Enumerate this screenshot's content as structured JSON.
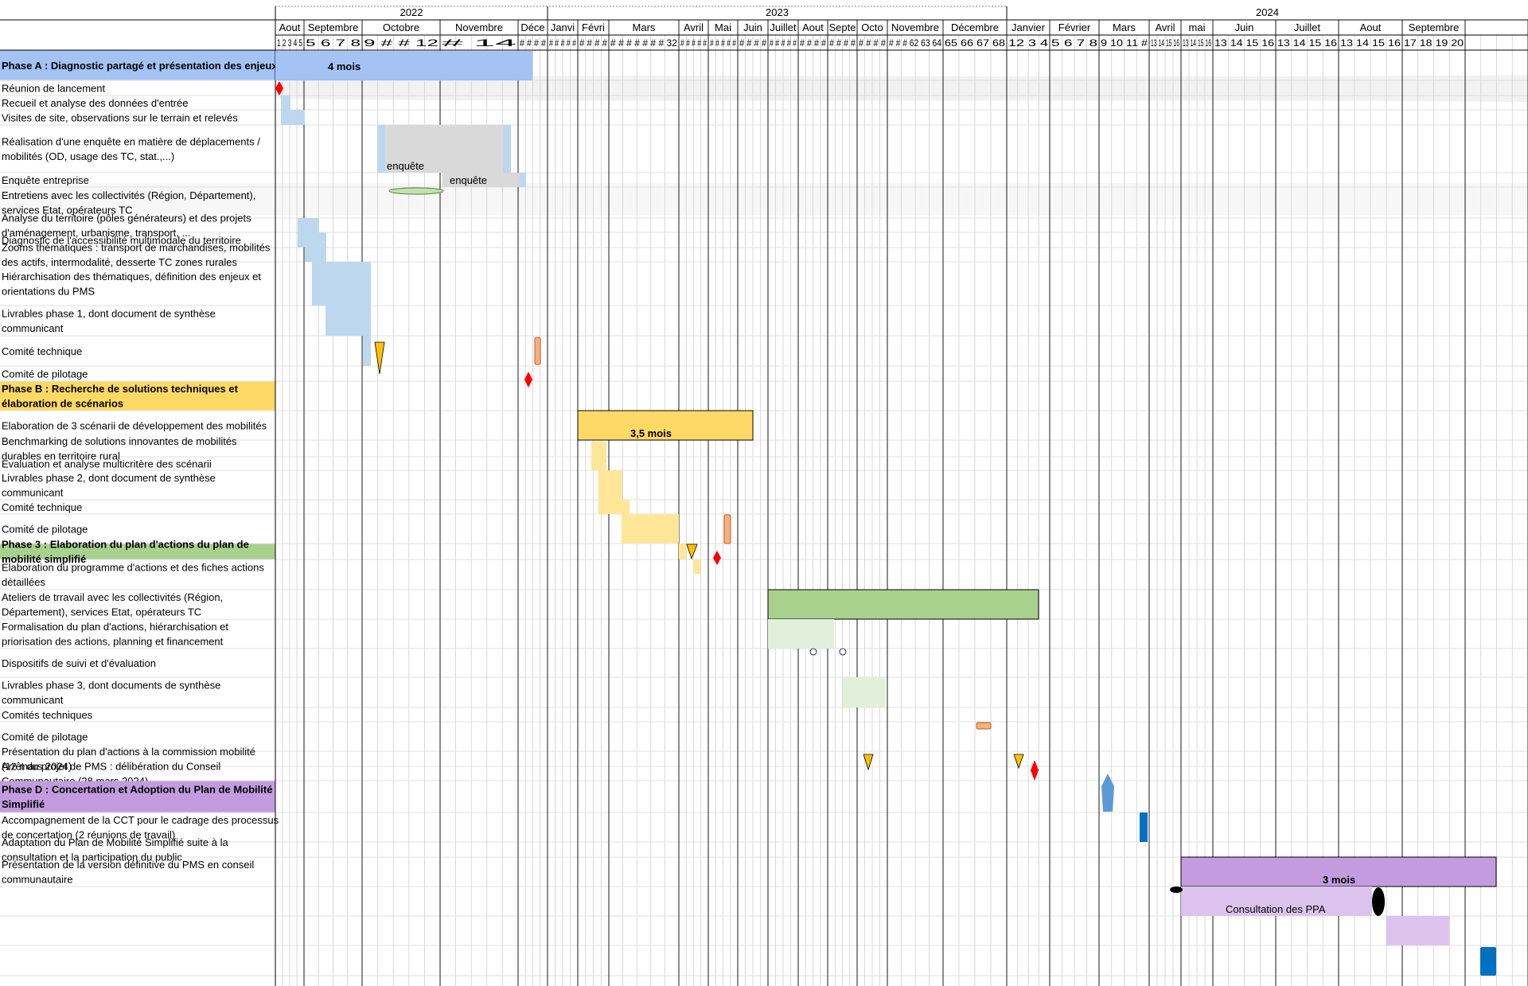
{
  "years": [
    {
      "label": "2022",
      "months": [
        {
          "label": "Aout",
          "weeks": "1 2 3 4 5"
        },
        {
          "label": "Septembre",
          "weeks": "5 6 7       8"
        },
        {
          "label": "Octobre",
          "weeks": "9 # #               12"
        },
        {
          "label": "Novembre",
          "weeks": "#                 14"
        },
        {
          "label": "Déce",
          "weeks": "# # # #"
        }
      ]
    },
    {
      "label": "2023",
      "months": [
        {
          "label": "Janvi",
          "weeks": "# # # # #"
        },
        {
          "label": "Févri",
          "weeks": "# # # #"
        },
        {
          "label": "Mars",
          "weeks": "# # # # # # #      32"
        },
        {
          "label": "Avril",
          "weeks": "# # # # #"
        },
        {
          "label": "Mai",
          "weeks": "# # # # #"
        },
        {
          "label": "Juin",
          "weeks": "# # # #"
        },
        {
          "label": "Juillet",
          "weeks": "# # # # #"
        },
        {
          "label": "Aout",
          "weeks": "# # # #"
        },
        {
          "label": "Septe",
          "weeks": "# # # #"
        },
        {
          "label": "Octo",
          "weeks": "# # # #"
        },
        {
          "label": "Novembre",
          "weeks": "# # # 62 63 64"
        },
        {
          "label": "Décembre",
          "weeks": "65 66 67 68"
        }
      ]
    },
    {
      "label": "2024",
      "months": [
        {
          "label": "Janvier",
          "weeks": "12 3 4"
        },
        {
          "label": "Février",
          "weeks": "5 6 7 8"
        },
        {
          "label": "Mars",
          "weeks": "9 10 11 #"
        },
        {
          "label": "Avril",
          "weeks": "13 14 15 16"
        },
        {
          "label": "mai",
          "weeks": "13 14 15 16"
        },
        {
          "label": "Juin",
          "weeks": "13 14 15 16"
        },
        {
          "label": "Juillet",
          "weeks": "13 14 15 16"
        },
        {
          "label": "Aout",
          "weeks": "13 14 15 16"
        },
        {
          "label": "Septembre",
          "weeks": "17 18 19 20"
        }
      ]
    }
  ],
  "rows": [
    {
      "kind": "phase",
      "lines": [
        "Phase A : Diagnostic partagé et présentation des enjeux"
      ],
      "color": "#a4c2f4",
      "duration": "4 mois"
    },
    {
      "kind": "task",
      "lines": [
        "Réunion de lancement"
      ]
    },
    {
      "kind": "task",
      "lines": [
        "Recueil et analyse des données d'entrée"
      ]
    },
    {
      "kind": "task",
      "lines": [
        "Visites de site, observations sur le terrain et relevés"
      ]
    },
    {
      "kind": "task",
      "lines": [
        "Réalisation d'une enquête en matière de déplacements /",
        "mobilités (OD, usage des TC, stat.,...)"
      ]
    },
    {
      "kind": "task",
      "lines": [
        "Enquête entreprise"
      ]
    },
    {
      "kind": "task",
      "lines": [
        "Entretiens avec les collectivités (Région, Département),",
        "services Etat, opérateurs TC"
      ]
    },
    {
      "kind": "task",
      "lines": [
        "Analyse du territoire (pôles générateurs) et des projets",
        "d'aménagement, urbanisme, transport, ..."
      ]
    },
    {
      "kind": "task",
      "lines": [
        "Diagnostic de l'accessibilité multimodale du territoire"
      ]
    },
    {
      "kind": "task",
      "lines": [
        "Zooms thématiques : transport de marchandises, mobilités",
        "des actifs, intermodalité, desserte TC zones rurales"
      ]
    },
    {
      "kind": "task",
      "lines": [
        "Hiérarchisation des thématiques, définition des enjeux et",
        "orientations du PMS"
      ]
    },
    {
      "kind": "task",
      "lines": [
        "Livrables phase 1, dont document de synthèse",
        "communicant"
      ]
    },
    {
      "kind": "task",
      "lines": [
        "Comité technique"
      ]
    },
    {
      "kind": "task",
      "lines": [
        "Comité de pilotage"
      ]
    },
    {
      "kind": "phase",
      "lines": [
        "Phase B : Recherche de solutions techniques et",
        "élaboration de scénarios"
      ],
      "color": "#ffd966",
      "duration": "3,5 mois"
    },
    {
      "kind": "task",
      "lines": [
        "Elaboration de 3 scénarii de développement des mobilités"
      ]
    },
    {
      "kind": "task",
      "lines": [
        "Benchmarking de solutions innovantes de mobilités",
        "durables en territoire rural"
      ]
    },
    {
      "kind": "task",
      "lines": [
        "Evaluation et analyse multicritère des scénarii"
      ]
    },
    {
      "kind": "task",
      "lines": [
        "Livrables phase 2, dont document de synthèse",
        "communicant"
      ]
    },
    {
      "kind": "task",
      "lines": [
        "Comité technique"
      ]
    },
    {
      "kind": "task",
      "lines": [
        "Comité de pilotage"
      ]
    },
    {
      "kind": "phase",
      "lines": [
        "Phase 3 : Elaboration du plan d'actions du plan de",
        "mobilité simplifié"
      ],
      "color": "#a9d18e",
      "duration": ""
    },
    {
      "kind": "task",
      "lines": [
        "Elaboration du programme d'actions et des fiches actions",
        "détaillées"
      ]
    },
    {
      "kind": "task",
      "lines": [
        "Ateliers de trravail avec les collectivités (Région,",
        "Département), services Etat, opérateurs TC"
      ]
    },
    {
      "kind": "task",
      "lines": [
        "Formalisation du plan d'actions, hiérarchisation et",
        "priorisation des actions, planning et financement"
      ]
    },
    {
      "kind": "task",
      "lines": [
        "Dispositifs de suivi et d'évaluation"
      ]
    },
    {
      "kind": "task",
      "lines": [
        "Livrables phase 3, dont  documents de synthèse",
        "communicant"
      ]
    },
    {
      "kind": "task",
      "lines": [
        "Comités techniques"
      ]
    },
    {
      "kind": "task",
      "lines": [
        "Comité de pilotage"
      ]
    },
    {
      "kind": "task",
      "lines": [
        "Présentation du plan d'actions à la commission mobilité",
        "(12 mars 2024)"
      ]
    },
    {
      "kind": "task",
      "lines": [
        "Arrêt du projet de PMS : délibération du Conseil",
        "Communautaire (28 mars 2024)"
      ]
    },
    {
      "kind": "phase",
      "lines": [
        "Phase D : Concertation et Adoption du Plan de Mobilité",
        "Simplifié"
      ],
      "color": "#c39ce0",
      "duration": "3 mois"
    },
    {
      "kind": "task",
      "lines": [
        "Accompagnement de la CCT pour le cadrage des processus",
        "de concertation (2 réunions de travail)"
      ]
    },
    {
      "kind": "task",
      "lines": [
        "Adaptation du Plan de Mobilité Simplifié suite à la",
        "consultation et la participation du public"
      ]
    },
    {
      "kind": "task",
      "lines": [
        "Présentation de la version définitive du PMS en conseil",
        "communautaire"
      ]
    }
  ],
  "bar_labels": {
    "enquete_1": "enquête",
    "enquete_2": "enquête",
    "consultation": "Consultation des PPA"
  },
  "colors": {
    "phase_a_light": "#bdd7ee",
    "phase_b_light": "#ffe699",
    "phase_c_light": "#e2efda",
    "phase_d_light": "#dcc3ee",
    "survey_gray": "#d9d9d9",
    "milestone_red": "#ff0000",
    "milestone_yellow": "#ffc000",
    "deliverable_orange": "#f4b183",
    "blue_marker": "#5b9bd5",
    "dark_blue_marker": "#0070c0"
  }
}
